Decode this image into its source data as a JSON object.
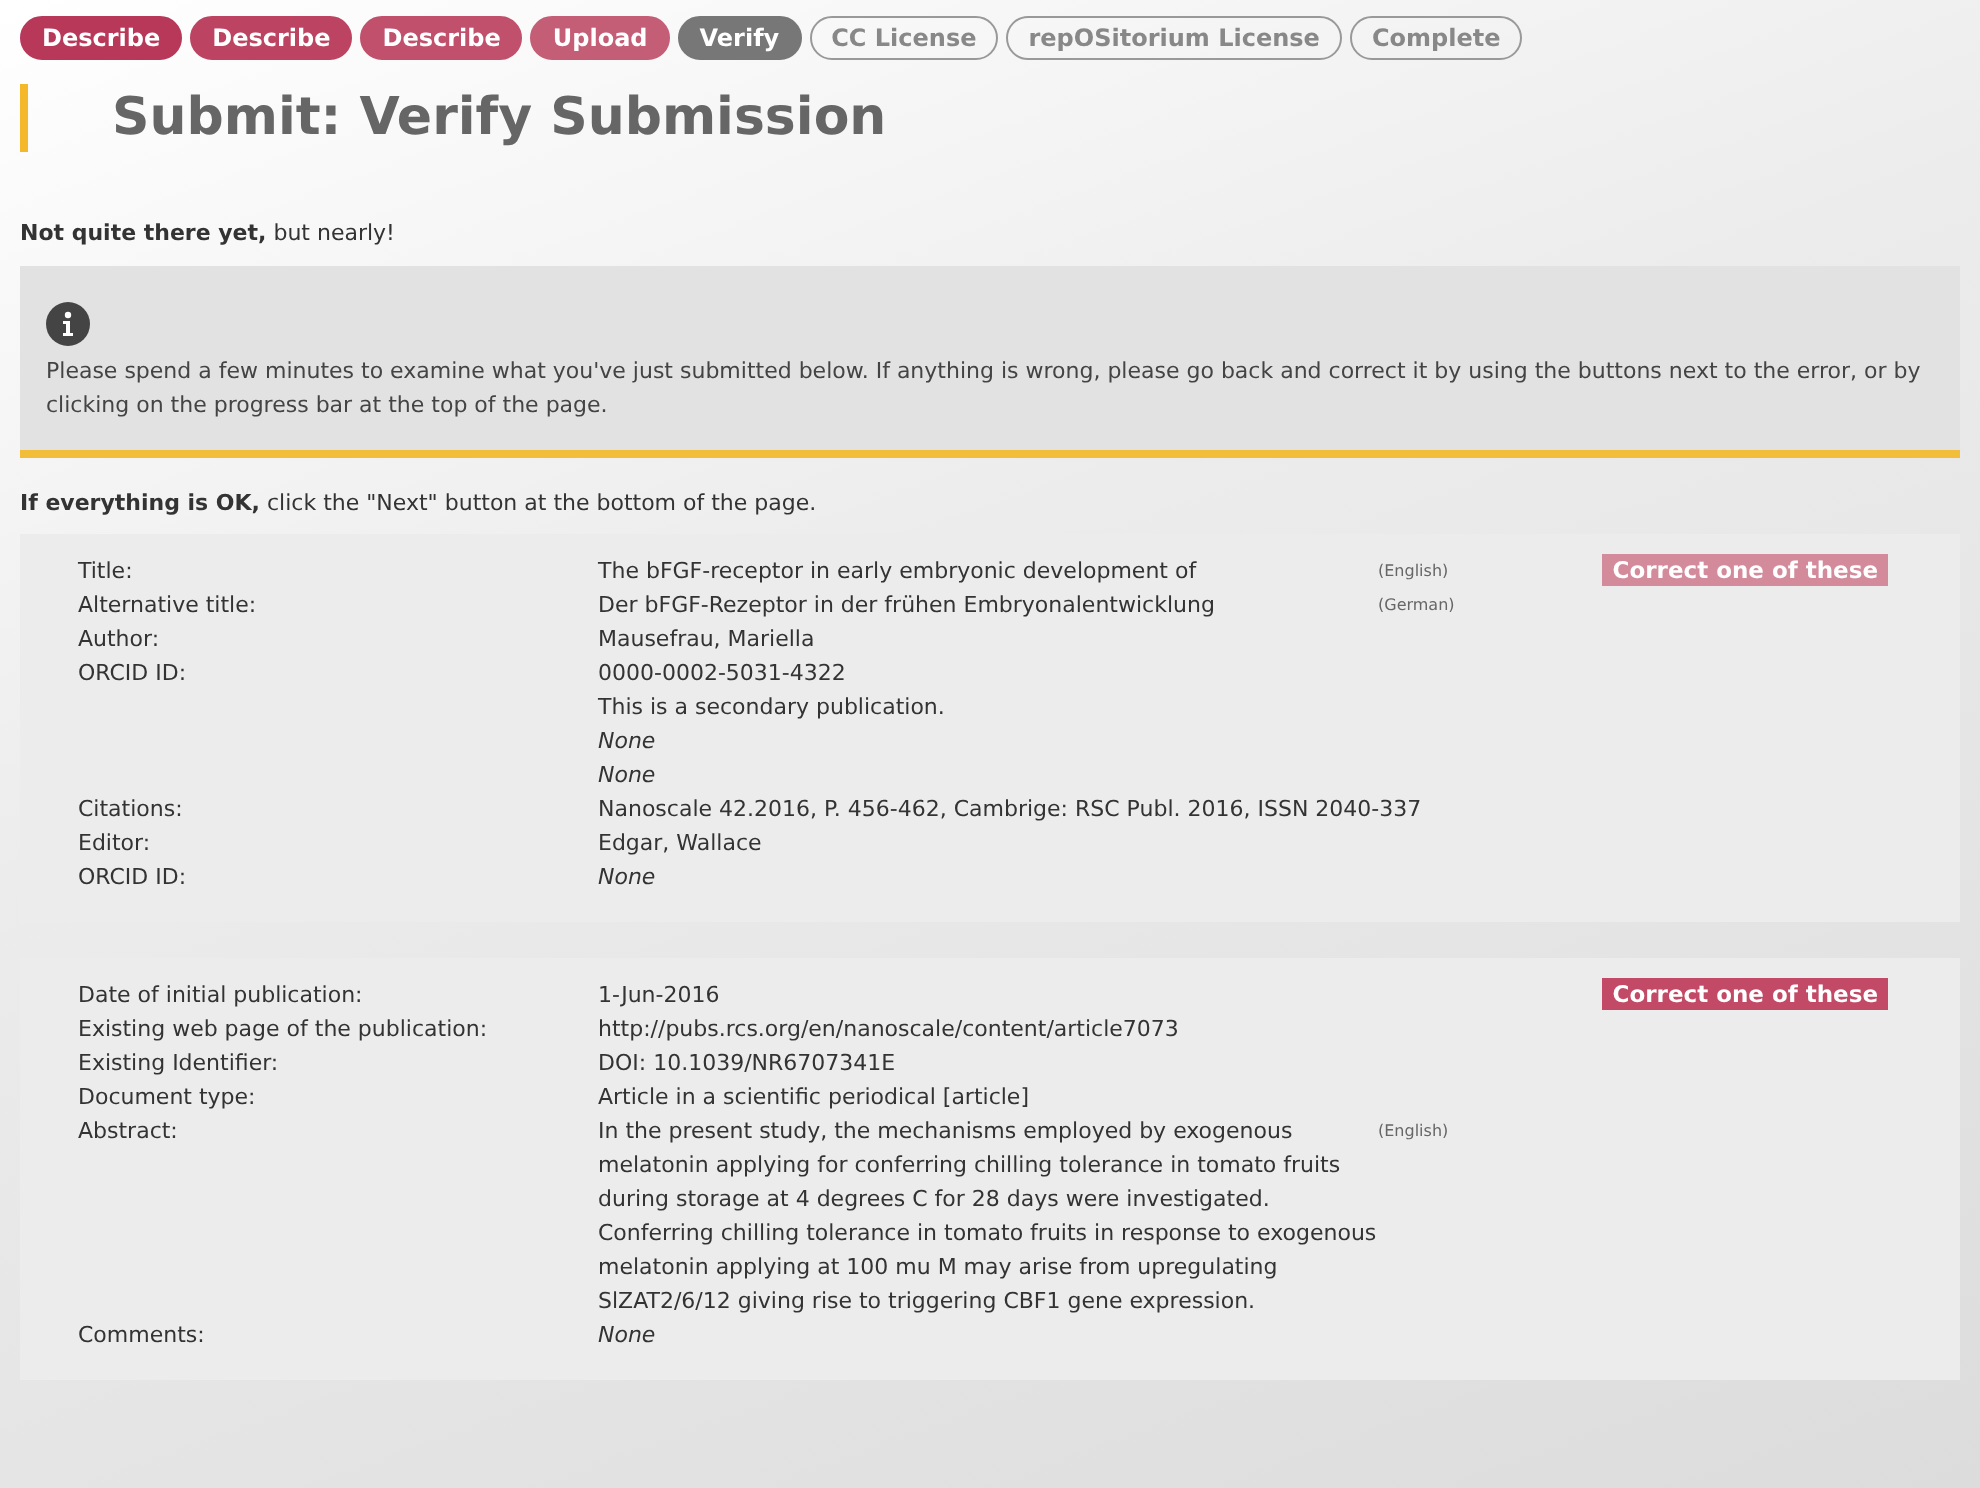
{
  "steps": [
    {
      "label": "Describe",
      "kind": "done",
      "color": "#b8385a"
    },
    {
      "label": "Describe",
      "kind": "done",
      "color": "#bc4462"
    },
    {
      "label": "Describe",
      "kind": "done",
      "color": "#c0506c"
    },
    {
      "label": "Upload",
      "kind": "done",
      "color": "#c45e76"
    },
    {
      "label": "Verify",
      "kind": "current"
    },
    {
      "label": "CC License",
      "kind": "todo"
    },
    {
      "label": "repOSitorium License",
      "kind": "todo"
    },
    {
      "label": "Complete",
      "kind": "todo"
    }
  ],
  "title": "Submit: Verify Submission",
  "status": "**Not quite there yet,** but nearly!",
  "info": {
    "text": "Please spend a few minutes to examine what you've just submitted below. If anything is wrong, please go back and correct it by using the buttons next to the error, or by clicking on the progress bar at the top of the page."
  },
  "hint": "**If everything is OK,** click the \"Next\" button at the bottom of the page.",
  "sections": [
    {
      "button": {
        "label": "Correct one of these",
        "disabled": true
      },
      "rows": [
        {
          "label": "Title:",
          "value": "The bFGF-receptor in early embryonic development of",
          "italic": false,
          "lang": "(English)"
        },
        {
          "label": "Alternative title:",
          "value": "Der bFGF-Rezeptor in der frühen Embryonalentwicklung",
          "italic": false,
          "lang": "(German)"
        },
        {
          "label": "Author:",
          "value": "Mausefrau, Mariella",
          "italic": false
        },
        {
          "label": "ORCID ID:",
          "value": "0000-0002-5031-4322",
          "italic": false
        },
        {
          "value": "This is a secondary publication.",
          "italic": false
        },
        {
          "value": "None",
          "italic": true
        },
        {
          "value": "None",
          "italic": true
        },
        {
          "label": "Citations:",
          "value": "Nanoscale 42.2016, P. 456-462, Cambrige: RSC Publ. 2016, ISSN 2040-337",
          "italic": false
        },
        {
          "label": "Editor:",
          "value": "Edgar, Wallace",
          "italic": false
        },
        {
          "label": "ORCID ID:",
          "value": "None",
          "italic": true
        }
      ]
    },
    {
      "button": {
        "label": "Correct one of these",
        "disabled": false
      },
      "rows": [
        {
          "label": "Date of initial publication:",
          "value": "1-Jun-2016",
          "italic": false
        },
        {
          "label": "Existing web page of the publication:",
          "value": "http://pubs.rcs.org/en/nanoscale/content/article7073",
          "italic": false
        },
        {
          "label": "Existing Identifier:",
          "value": "DOI: 10.1039/NR6707341E",
          "italic": false
        },
        {
          "label": "Document type:",
          "value": "Article in a scientific periodical [article]",
          "italic": false
        },
        {
          "label": "Abstract:",
          "value": "In the present study, the mechanisms employed by exogenous melatonin applying for conferring chilling tolerance in tomato fruits during storage at 4 degrees C for 28 days were investigated. Conferring chilling tolerance in tomato fruits in response to exogenous melatonin applying at 100 mu M may arise from upregulating SlZAT2/6/12 giving rise to triggering CBF1 gene expression.",
          "italic": false,
          "lang": "(English)"
        },
        {
          "label": "Comments:",
          "value": "None",
          "italic": true
        }
      ]
    }
  ]
}
